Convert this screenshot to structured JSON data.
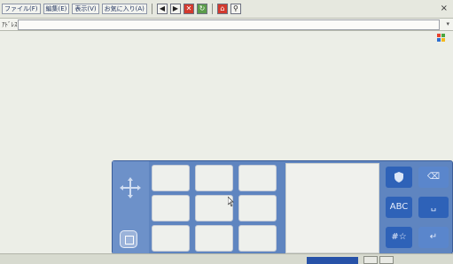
{
  "menubar": {
    "items": [
      "ファイル(F)",
      "編集(E)",
      "表示(V)",
      "お気に入り(A)"
    ],
    "close_glyph": "×"
  },
  "toolbar": {
    "buttons": [
      {
        "icon": "back-icon",
        "glyph": "◀"
      },
      {
        "icon": "forward-icon",
        "glyph": "▶"
      },
      {
        "icon": "stop-icon",
        "glyph": "✕"
      },
      {
        "icon": "refresh-icon",
        "glyph": "↻"
      },
      {
        "icon": "home-icon",
        "glyph": "⌂"
      },
      {
        "icon": "search-icon",
        "glyph": "⚲"
      }
    ]
  },
  "address": {
    "label": "ｱﾄﾞﾚｽ",
    "value": "",
    "dropdown_glyph": "▾"
  },
  "keyboard": {
    "abc_label": "ABC",
    "symbols_label": "#☆",
    "backspace_glyph": "⌫",
    "space_glyph": "␣",
    "enter_glyph": "↵",
    "colors": {
      "panel": "#5f85c0",
      "button": "#2e62b8"
    }
  }
}
